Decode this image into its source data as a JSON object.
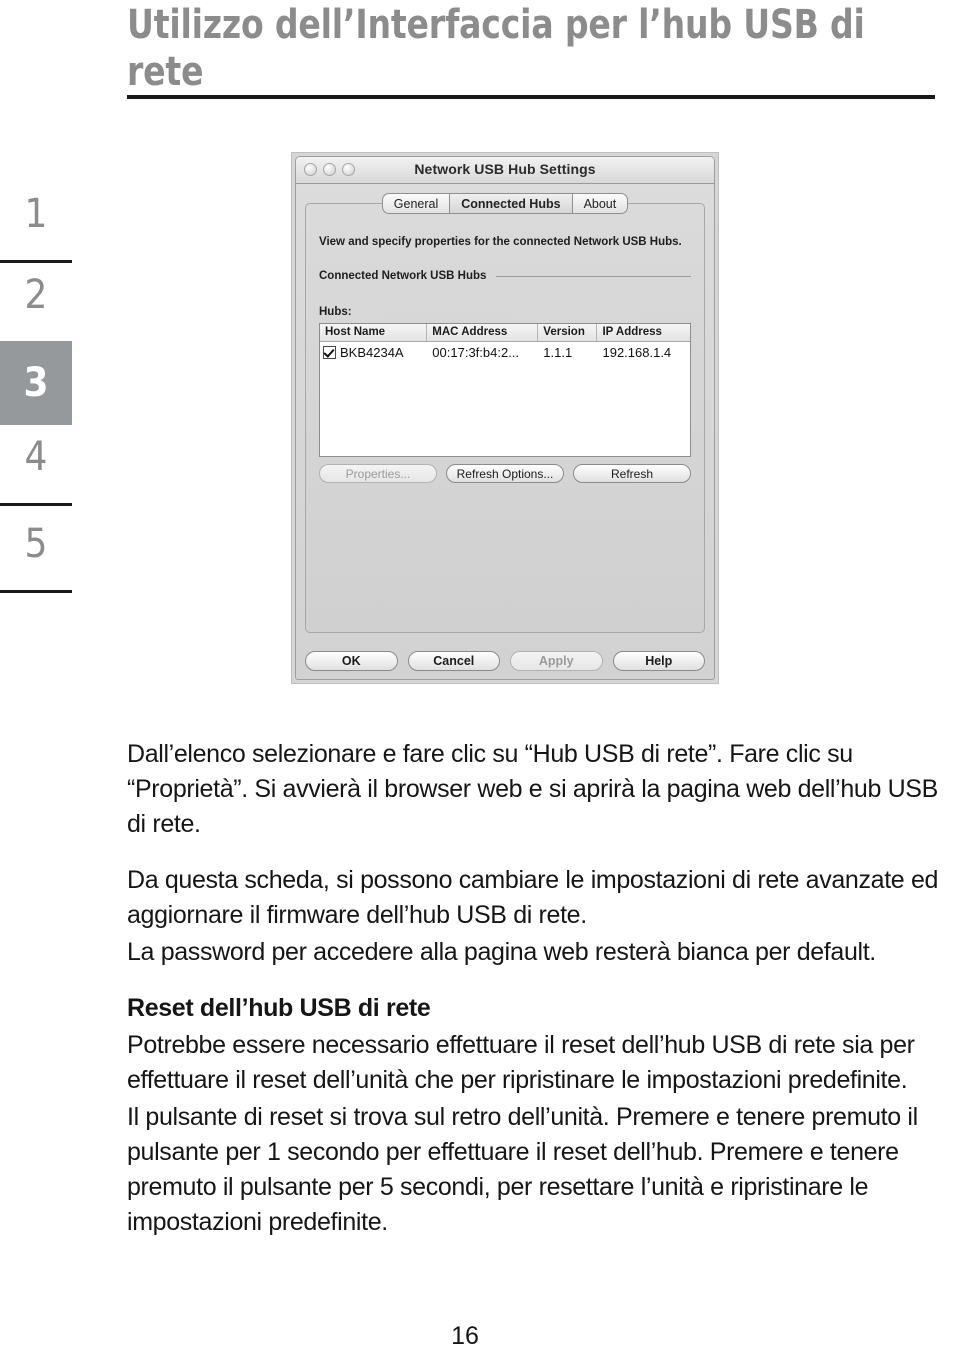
{
  "page": {
    "heading": "Utilizzo dell’Interfaccia per l’hub USB di rete",
    "number": "16"
  },
  "step_rail": {
    "steps": [
      {
        "label": "1",
        "active": false
      },
      {
        "label": "2",
        "active": false
      },
      {
        "label": "3",
        "active": true
      },
      {
        "label": "4",
        "active": false
      },
      {
        "label": "5",
        "active": false
      }
    ],
    "active_bg": "#96999c",
    "inactive_color": "#8c8c8c"
  },
  "figure": {
    "window_title": "Network USB Hub Settings",
    "traffic_lights": [
      "close-button",
      "minimize-button",
      "zoom-button"
    ],
    "tabs": [
      {
        "label": "General",
        "selected": false
      },
      {
        "label": "Connected Hubs",
        "selected": true
      },
      {
        "label": "About",
        "selected": false
      }
    ],
    "description": "View and specify properties for the connected Network USB Hubs.",
    "group_label": "Connected Network USB Hubs",
    "list_label": "Hubs:",
    "table": {
      "columns": [
        "Host Name",
        "MAC Address",
        "Version",
        "IP Address"
      ],
      "rows": [
        {
          "checked": true,
          "host_name": "BKB4234A",
          "mac_address": "00:17:3f:b4:2...",
          "version": "1.1.1",
          "ip_address": "192.168.1.4"
        }
      ]
    },
    "list_buttons": [
      {
        "label": "Properties...",
        "enabled": false
      },
      {
        "label": "Refresh Options...",
        "enabled": true
      },
      {
        "label": "Refresh",
        "enabled": true
      }
    ],
    "footer_buttons": [
      {
        "label": "OK",
        "enabled": true
      },
      {
        "label": "Cancel",
        "enabled": true
      },
      {
        "label": "Apply",
        "enabled": false
      },
      {
        "label": "Help",
        "enabled": true
      }
    ]
  },
  "body": {
    "para1": "Dall’elenco selezionare e fare clic su “Hub USB di rete”. Fare clic su “Proprietà”. Si avvierà il browser web e si aprirà la pagina web dell’hub USB di rete.",
    "para2": "Da questa scheda, si possono cambiare le impostazioni di rete avanzate ed aggiornare il firmware dell’hub USB di rete.",
    "para3": "La password per accedere alla pagina web resterà bianca per default.",
    "subheading": "Reset dell’hub USB di rete",
    "para4": "Potrebbe essere necessario effettuare il reset dell’hub USB di rete sia per effettuare il reset dell’unità che per ripristinare le impostazioni predefinite.",
    "para5": "Il pulsante di reset si trova sul retro dell’unità. Premere e tenere premuto il pulsante per 1 secondo per effettuare il reset dell’hub. Premere e tenere premuto il pulsante per 5 secondi, per resettare l’unità e ripristinare le impostazioni predefinite."
  }
}
